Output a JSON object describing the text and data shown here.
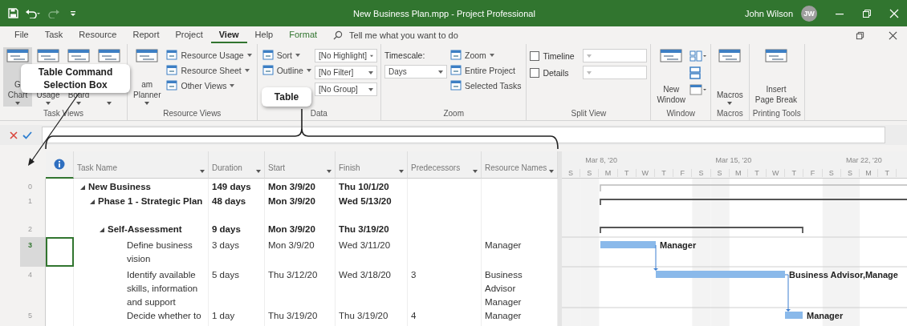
{
  "window": {
    "title": "New Business Plan.mpp  -  Project Professional",
    "user": "John Wilson",
    "avatar": "JW"
  },
  "menu": {
    "tabs": [
      {
        "label": "File",
        "selected": false,
        "contextual": false
      },
      {
        "label": "Task",
        "selected": false,
        "contextual": false
      },
      {
        "label": "Resource",
        "selected": false,
        "contextual": false
      },
      {
        "label": "Report",
        "selected": false,
        "contextual": false
      },
      {
        "label": "Project",
        "selected": false,
        "contextual": false
      },
      {
        "label": "View",
        "selected": true,
        "contextual": false
      },
      {
        "label": "Help",
        "selected": false,
        "contextual": false
      },
      {
        "label": "Format",
        "selected": false,
        "contextual": true
      }
    ],
    "search": {
      "placeholder": "Tell me what you want to do"
    }
  },
  "ribbon": [
    {
      "label": "Task Views",
      "items": [
        {
          "kind": "large",
          "lines": [
            "G",
            "Chart"
          ],
          "dropdown": true,
          "selected": true
        },
        {
          "kind": "large",
          "lines": [
            "Usage"
          ],
          "dropdown": true,
          "selected": false
        },
        {
          "kind": "large",
          "lines": [
            "Board"
          ],
          "dropdown": true,
          "selected": false
        },
        {
          "kind": "large",
          "dropdown": true,
          "selected": false
        }
      ]
    },
    {
      "label": "Resource Views",
      "items": [
        {
          "kind": "large",
          "lines": [
            "am",
            "Planner"
          ],
          "dropdown": true,
          "selected": false
        },
        {
          "kind": "stack",
          "entries": [
            {
              "kind": "button",
              "label": "Resource Usage",
              "dropdown": true
            },
            {
              "kind": "button",
              "label": "Resource Sheet",
              "dropdown": true
            },
            {
              "kind": "button",
              "label": "Other Views",
              "dropdown": true
            }
          ]
        }
      ]
    },
    {
      "label": "Data",
      "items": [
        {
          "kind": "stack",
          "entries": [
            {
              "kind": "button",
              "label": "Sort",
              "dropdown": true
            },
            {
              "kind": "button",
              "label": "Outline",
              "dropdown": true
            }
          ]
        },
        {
          "kind": "stack",
          "entries": [
            {
              "kind": "combo",
              "value": "[No Highlight]"
            },
            {
              "kind": "combo",
              "value": "[No Filter]"
            },
            {
              "kind": "combo",
              "value": "[No Group]"
            }
          ]
        }
      ]
    },
    {
      "label": "Zoom",
      "items": [
        {
          "kind": "stack",
          "entries": [
            {
              "kind": "label",
              "label": "Timescale:"
            },
            {
              "kind": "combo",
              "value": "Days"
            }
          ]
        },
        {
          "kind": "stack",
          "entries": [
            {
              "kind": "button",
              "label": "Zoom",
              "dropdown": true
            },
            {
              "kind": "button",
              "label": "Entire Project",
              "dropdown": false
            },
            {
              "kind": "button",
              "label": "Selected Tasks",
              "dropdown": false
            }
          ]
        }
      ]
    },
    {
      "label": "Split View",
      "items": [
        {
          "kind": "stack",
          "entries": [
            {
              "kind": "check",
              "label": "Timeline",
              "checked": false
            },
            {
              "kind": "check",
              "label": "Details",
              "checked": false
            }
          ]
        }
      ]
    },
    {
      "label": "Window",
      "items": [
        {
          "kind": "large",
          "lines": [
            "New",
            "Window"
          ],
          "dropdown": false,
          "selected": false
        },
        {
          "kind": "icons"
        }
      ]
    },
    {
      "label": "Macros",
      "items": [
        {
          "kind": "large",
          "lines": [
            "Macros"
          ],
          "dropdown": true,
          "selected": false
        }
      ]
    },
    {
      "label": "Printing Tools",
      "items": [
        {
          "kind": "large",
          "lines": [
            "Insert",
            "Page Break"
          ],
          "dropdown": false,
          "selected": false
        }
      ]
    }
  ],
  "callouts": [
    {
      "text": "Table Command Selection Box"
    },
    {
      "text": "Table"
    }
  ],
  "table": {
    "columns": [
      {
        "label": "Task Name"
      },
      {
        "label": "Duration"
      },
      {
        "label": "Start"
      },
      {
        "label": "Finish"
      },
      {
        "label": "Predecessors"
      },
      {
        "label": "Resource Names"
      }
    ],
    "rows": [
      {
        "id": "0",
        "name": "New Business",
        "duration": "149 days",
        "start": "Mon 3/9/20",
        "finish": "Thu 10/1/20",
        "summary": true,
        "expanded": true,
        "selected": false,
        "children": [
          {
            "id": "1",
            "name": "Phase 1 - Strategic Plan",
            "duration": "48 days",
            "start": "Mon 3/9/20",
            "finish": "Wed 5/13/20",
            "summary": true,
            "expanded": true,
            "selected": false,
            "children": [
              {
                "id": "2",
                "name": "Self-Assessment",
                "duration": "9 days",
                "start": "Mon 3/9/20",
                "finish": "Thu 3/19/20",
                "summary": true,
                "expanded": true,
                "selected": false,
                "children": [
                  {
                    "id": "3",
                    "name": "Define business vision",
                    "duration": "3 days",
                    "start": "Mon 3/9/20",
                    "finish": "Wed 3/11/20",
                    "resources": "Manager",
                    "summary": false,
                    "selected": true
                  },
                  {
                    "id": "4",
                    "name": "Identify available skills, information and support",
                    "duration": "5 days",
                    "start": "Thu 3/12/20",
                    "finish": "Wed 3/18/20",
                    "predecessors": "3",
                    "resources": "Business Advisor Manager",
                    "summary": false,
                    "selected": false
                  },
                  {
                    "id": "5",
                    "name": "Decide whether to",
                    "duration": "1 day",
                    "start": "Thu 3/19/20",
                    "finish": "Thu 3/19/20",
                    "predecessors": "4",
                    "resources": "Manager",
                    "summary": false,
                    "selected": false
                  }
                ]
              }
            ]
          }
        ]
      }
    ]
  },
  "gantt": {
    "weeks": [
      "Mar 8, '20",
      "Mar 15, '20",
      "Mar 22, '20"
    ],
    "days": [
      "S",
      "S",
      "M",
      "T",
      "W",
      "T",
      "F",
      "S",
      "S",
      "M",
      "T",
      "W",
      "T",
      "F",
      "S",
      "S",
      "M",
      "T"
    ],
    "bars": [
      {
        "kind": "project"
      },
      {
        "kind": "summary"
      },
      {
        "kind": "summary"
      },
      {
        "kind": "task",
        "label": "Manager"
      },
      {
        "kind": "task",
        "label": "Business Advisor,Manage"
      },
      {
        "kind": "task",
        "label": "Manager"
      }
    ]
  }
}
